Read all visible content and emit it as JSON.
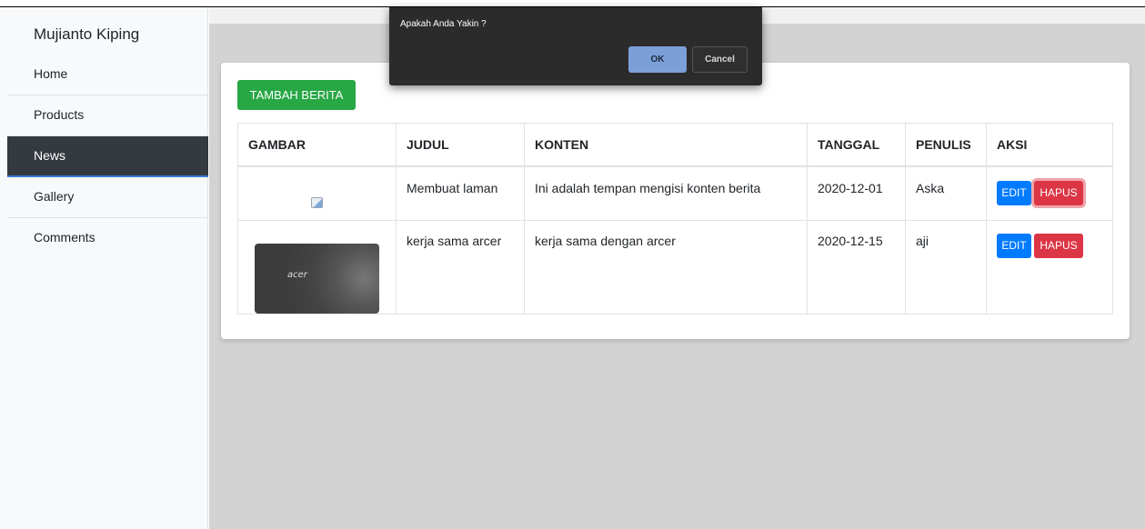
{
  "sidebar": {
    "brand": "Mujianto Kiping",
    "items": [
      {
        "label": "Home"
      },
      {
        "label": "Products"
      },
      {
        "label": "News"
      },
      {
        "label": "Gallery"
      },
      {
        "label": "Comments"
      }
    ],
    "active": "News"
  },
  "main": {
    "add_button": "TAMBAH BERITA",
    "table": {
      "headers": [
        "GAMBAR",
        "JUDUL",
        "KONTEN",
        "TANGGAL",
        "PENULIS",
        "AKSI"
      ],
      "rows": [
        {
          "image": "broken-image",
          "judul": "Membuat laman",
          "konten": "Ini adalah tempan mengisi konten berita",
          "tanggal": "2020-12-01",
          "penulis": "Aska",
          "edit": "EDIT",
          "hapus": "HAPUS"
        },
        {
          "image": "acer-thumbnail",
          "image_text": "acer",
          "judul": "kerja sama arcer",
          "konten": "kerja sama dengan arcer",
          "tanggal": "2020-12-15",
          "penulis": "aji",
          "edit": "EDIT",
          "hapus": "HAPUS"
        }
      ]
    }
  },
  "dialog": {
    "message": "Apakah Anda Yakin ?",
    "ok": "OK",
    "cancel": "Cancel"
  },
  "colors": {
    "sidebar_active": "#343a40",
    "add_button": "#28a745",
    "edit_button": "#007bff",
    "delete_button": "#dc3545",
    "dialog_bg": "#2b2b2b",
    "dialog_ok": "#7ba0d8"
  }
}
